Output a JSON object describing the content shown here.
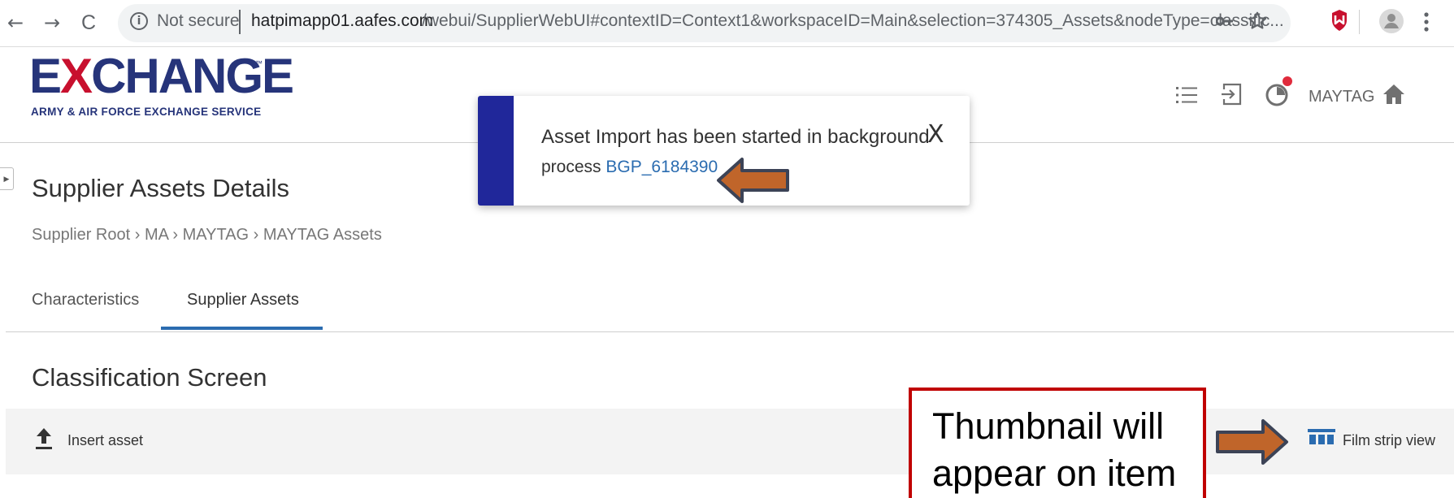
{
  "browser": {
    "back_glyph": "←",
    "forward_glyph": "→",
    "reload_glyph": "C",
    "info_glyph": "i",
    "security_label": "Not secure",
    "url_host": "hatpimapp01.aafes.com",
    "url_path": "/webui/SupplierWebUI#contextID=Context1&workspaceID=Main&selection=374305_Assets&nodeType=classific...",
    "icons": [
      "info-icon",
      "key-icon",
      "bookmark-star-icon",
      "shield-extension-icon",
      "profile-avatar-icon",
      "kebab-menu-icon"
    ]
  },
  "header": {
    "logo_text_pre": "E",
    "logo_text_x": "X",
    "logo_text_post": "CHANGE",
    "logo_tm": "™",
    "logo_subtitle": "ARMY & AIR FORCE EXCHANGE SERVICE",
    "user_name": "MAYTAG",
    "icons": [
      "list-icon",
      "import-icon",
      "notifications-icon",
      "home-icon"
    ]
  },
  "page": {
    "title": "Supplier Assets Details",
    "breadcrumb": "Supplier Root › MA › MAYTAG › MAYTAG Assets",
    "tabs": [
      {
        "label": "Characteristics",
        "active": false
      },
      {
        "label": "Supplier Assets",
        "active": true
      }
    ],
    "section_title": "Classification Screen",
    "toolbar": {
      "insert_label": "Insert asset",
      "filmstrip_label": "Film strip view"
    }
  },
  "toast": {
    "line1": "Asset Import has been started in background",
    "line2_prefix": "process ",
    "process_link": "BGP_6184390",
    "close_glyph": "X"
  },
  "annotation": {
    "callout_line1": "Thumbnail will",
    "callout_line2": "appear on item"
  },
  "colors": {
    "brand_navy": "#26347a",
    "brand_red": "#c8102e",
    "toast_accent": "#20279a",
    "link_blue": "#2b6cb0",
    "arrow_orange": "#c0652a",
    "arrow_outline": "#3c4356",
    "callout_border": "#c00000"
  }
}
